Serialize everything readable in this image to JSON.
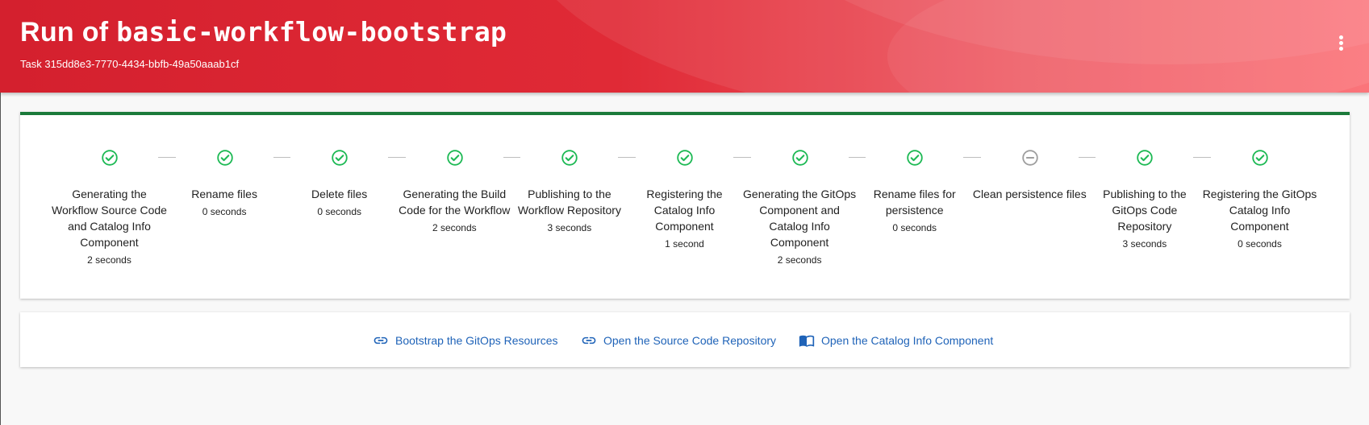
{
  "header": {
    "title_prefix": "Run of",
    "title_template": "basic-workflow-bootstrap",
    "task_label": "Task 315dd8e3-7770-4434-bbfb-49a50aaab1cf",
    "menu_icon": "more-vert-icon"
  },
  "steps": [
    {
      "label": "Generating the Workflow Source Code and Catalog Info Component",
      "duration": "2 seconds",
      "status": "completed",
      "icon": "check-circle-icon"
    },
    {
      "label": "Rename files",
      "duration": "0 seconds",
      "status": "completed",
      "icon": "check-circle-icon"
    },
    {
      "label": "Delete files",
      "duration": "0 seconds",
      "status": "completed",
      "icon": "check-circle-icon"
    },
    {
      "label": "Generating the Build Code for the Workflow",
      "duration": "2 seconds",
      "status": "completed",
      "icon": "check-circle-icon"
    },
    {
      "label": "Publishing to the Workflow Repository",
      "duration": "3 seconds",
      "status": "completed",
      "icon": "check-circle-icon"
    },
    {
      "label": "Registering the Catalog Info Component",
      "duration": "1 second",
      "status": "completed",
      "icon": "check-circle-icon"
    },
    {
      "label": "Generating the GitOps Component and Catalog Info Component",
      "duration": "2 seconds",
      "status": "completed",
      "icon": "check-circle-icon"
    },
    {
      "label": "Rename files for persistence",
      "duration": "0 seconds",
      "status": "completed",
      "icon": "check-circle-icon"
    },
    {
      "label": "Clean persistence files",
      "duration": "",
      "status": "skipped",
      "icon": "remove-circle-icon"
    },
    {
      "label": "Publishing to the GitOps Code Repository",
      "duration": "3 seconds",
      "status": "completed",
      "icon": "check-circle-icon"
    },
    {
      "label": "Registering the GitOps Catalog Info Component",
      "duration": "0 seconds",
      "status": "completed",
      "icon": "check-circle-icon"
    }
  ],
  "links": [
    {
      "label": "Bootstrap the GitOps Resources",
      "icon": "link-icon"
    },
    {
      "label": "Open the Source Code Repository",
      "icon": "link-icon"
    },
    {
      "label": "Open the Catalog Info Component",
      "icon": "catalog-book-icon"
    }
  ],
  "colors": {
    "header_red": "#e02a36",
    "progress_green": "#1b7a3a",
    "success_green": "#1db954",
    "skipped_gray": "#9e9e9e",
    "link_blue": "#1f63b8"
  }
}
